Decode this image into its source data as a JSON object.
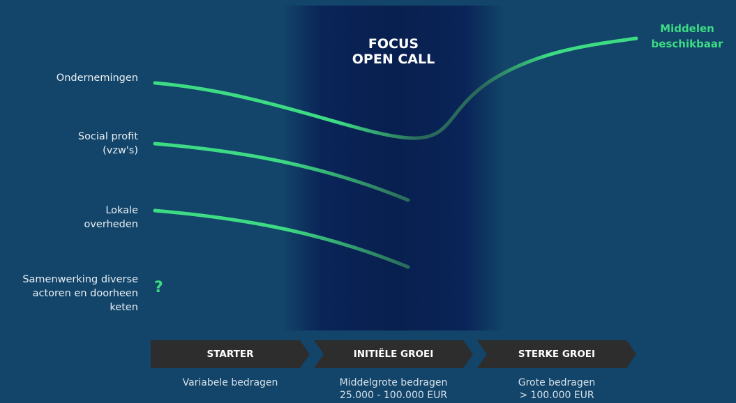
{
  "focus": {
    "line1": "FOCUS",
    "line2": "OPEN CALL"
  },
  "actors": [
    {
      "lines": [
        "Ondernemingen"
      ]
    },
    {
      "lines": [
        "Social profit",
        "(vzw's)"
      ]
    },
    {
      "lines": [
        "Lokale",
        "overheden"
      ]
    },
    {
      "lines": [
        "Samenwerking diverse",
        "actoren en doorheen",
        "keten"
      ]
    }
  ],
  "unknown_marker": "?",
  "available": {
    "line1": "Middelen",
    "line2": "beschikbaar"
  },
  "stages": [
    {
      "label": "STARTER",
      "sub": [
        "Variabele bedragen"
      ]
    },
    {
      "label": "INITIËLE GROEI",
      "sub": [
        "Middelgrote bedragen",
        "25.000 - 100.000 EUR"
      ]
    },
    {
      "label": "STERKE GROEI",
      "sub": [
        "Grote bedragen",
        "> 100.000 EUR"
      ]
    }
  ],
  "colors": {
    "background": "#124569",
    "focus_band": "#08204f",
    "curve": "#3ddc84",
    "curve_faded": "#2a6a5c",
    "stage_arrow": "#2d2d2d",
    "accent_text": "#3ddc84"
  }
}
